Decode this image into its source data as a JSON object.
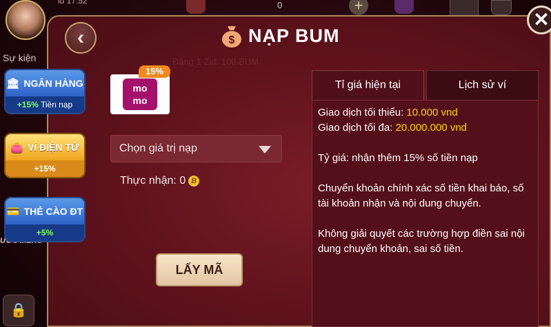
{
  "lobby": {
    "top_label": "lu 17:52",
    "top_count": "0",
    "su_kien": "Sự kiện",
    "uoc_merc": "ƯỚC MERC"
  },
  "dialog": {
    "title": "NẠP BUM",
    "watermark": "Đăng 1 Zid. 100 BUM"
  },
  "methods": [
    {
      "label": "NGÂN HÀNG",
      "bonus": "+15%",
      "bonus_suffix": "Tiền nạp",
      "icon": "bank-icon"
    },
    {
      "label": "VÍ ĐIỆN TỬ",
      "bonus": "+15%",
      "bonus_suffix": "",
      "icon": "wallet-icon"
    },
    {
      "label": "THẺ CÀO ĐT",
      "bonus": "+5%",
      "bonus_suffix": "",
      "icon": "card-icon"
    }
  ],
  "momo": {
    "badge": "15%",
    "logo_line1": "mo",
    "logo_line2": "mo"
  },
  "select": {
    "placeholder": "Chọn giá trị nạp"
  },
  "receive": {
    "label": "Thực nhận: 0"
  },
  "action": {
    "label": "LẤY MÃ"
  },
  "tabs": {
    "current": "Tỉ giá hiện tại",
    "history": "Lịch sử ví"
  },
  "info": {
    "min_label": "Giao dịch tối thiểu: ",
    "min_value": "10.000 vnd",
    "max_label": "Giao dịch tối đa: ",
    "max_value": "20.000.000 vnd",
    "rate": "Tỷ giá: nhận thêm 15% số tiền nạp",
    "instructions": "Chuyển khoản chính xác số tiền khai báo, số tài khoản nhận và nội dung chuyển.",
    "warning": "Không giải quyết các trường hợp điền sai nội dung chuyển khoản, sai số tiền."
  },
  "colors": {
    "accent_yellow": "#ffd400",
    "accent_green": "#57e33a",
    "accent_red": "#ff3b3b",
    "dialog_bg": "#5e121c"
  }
}
